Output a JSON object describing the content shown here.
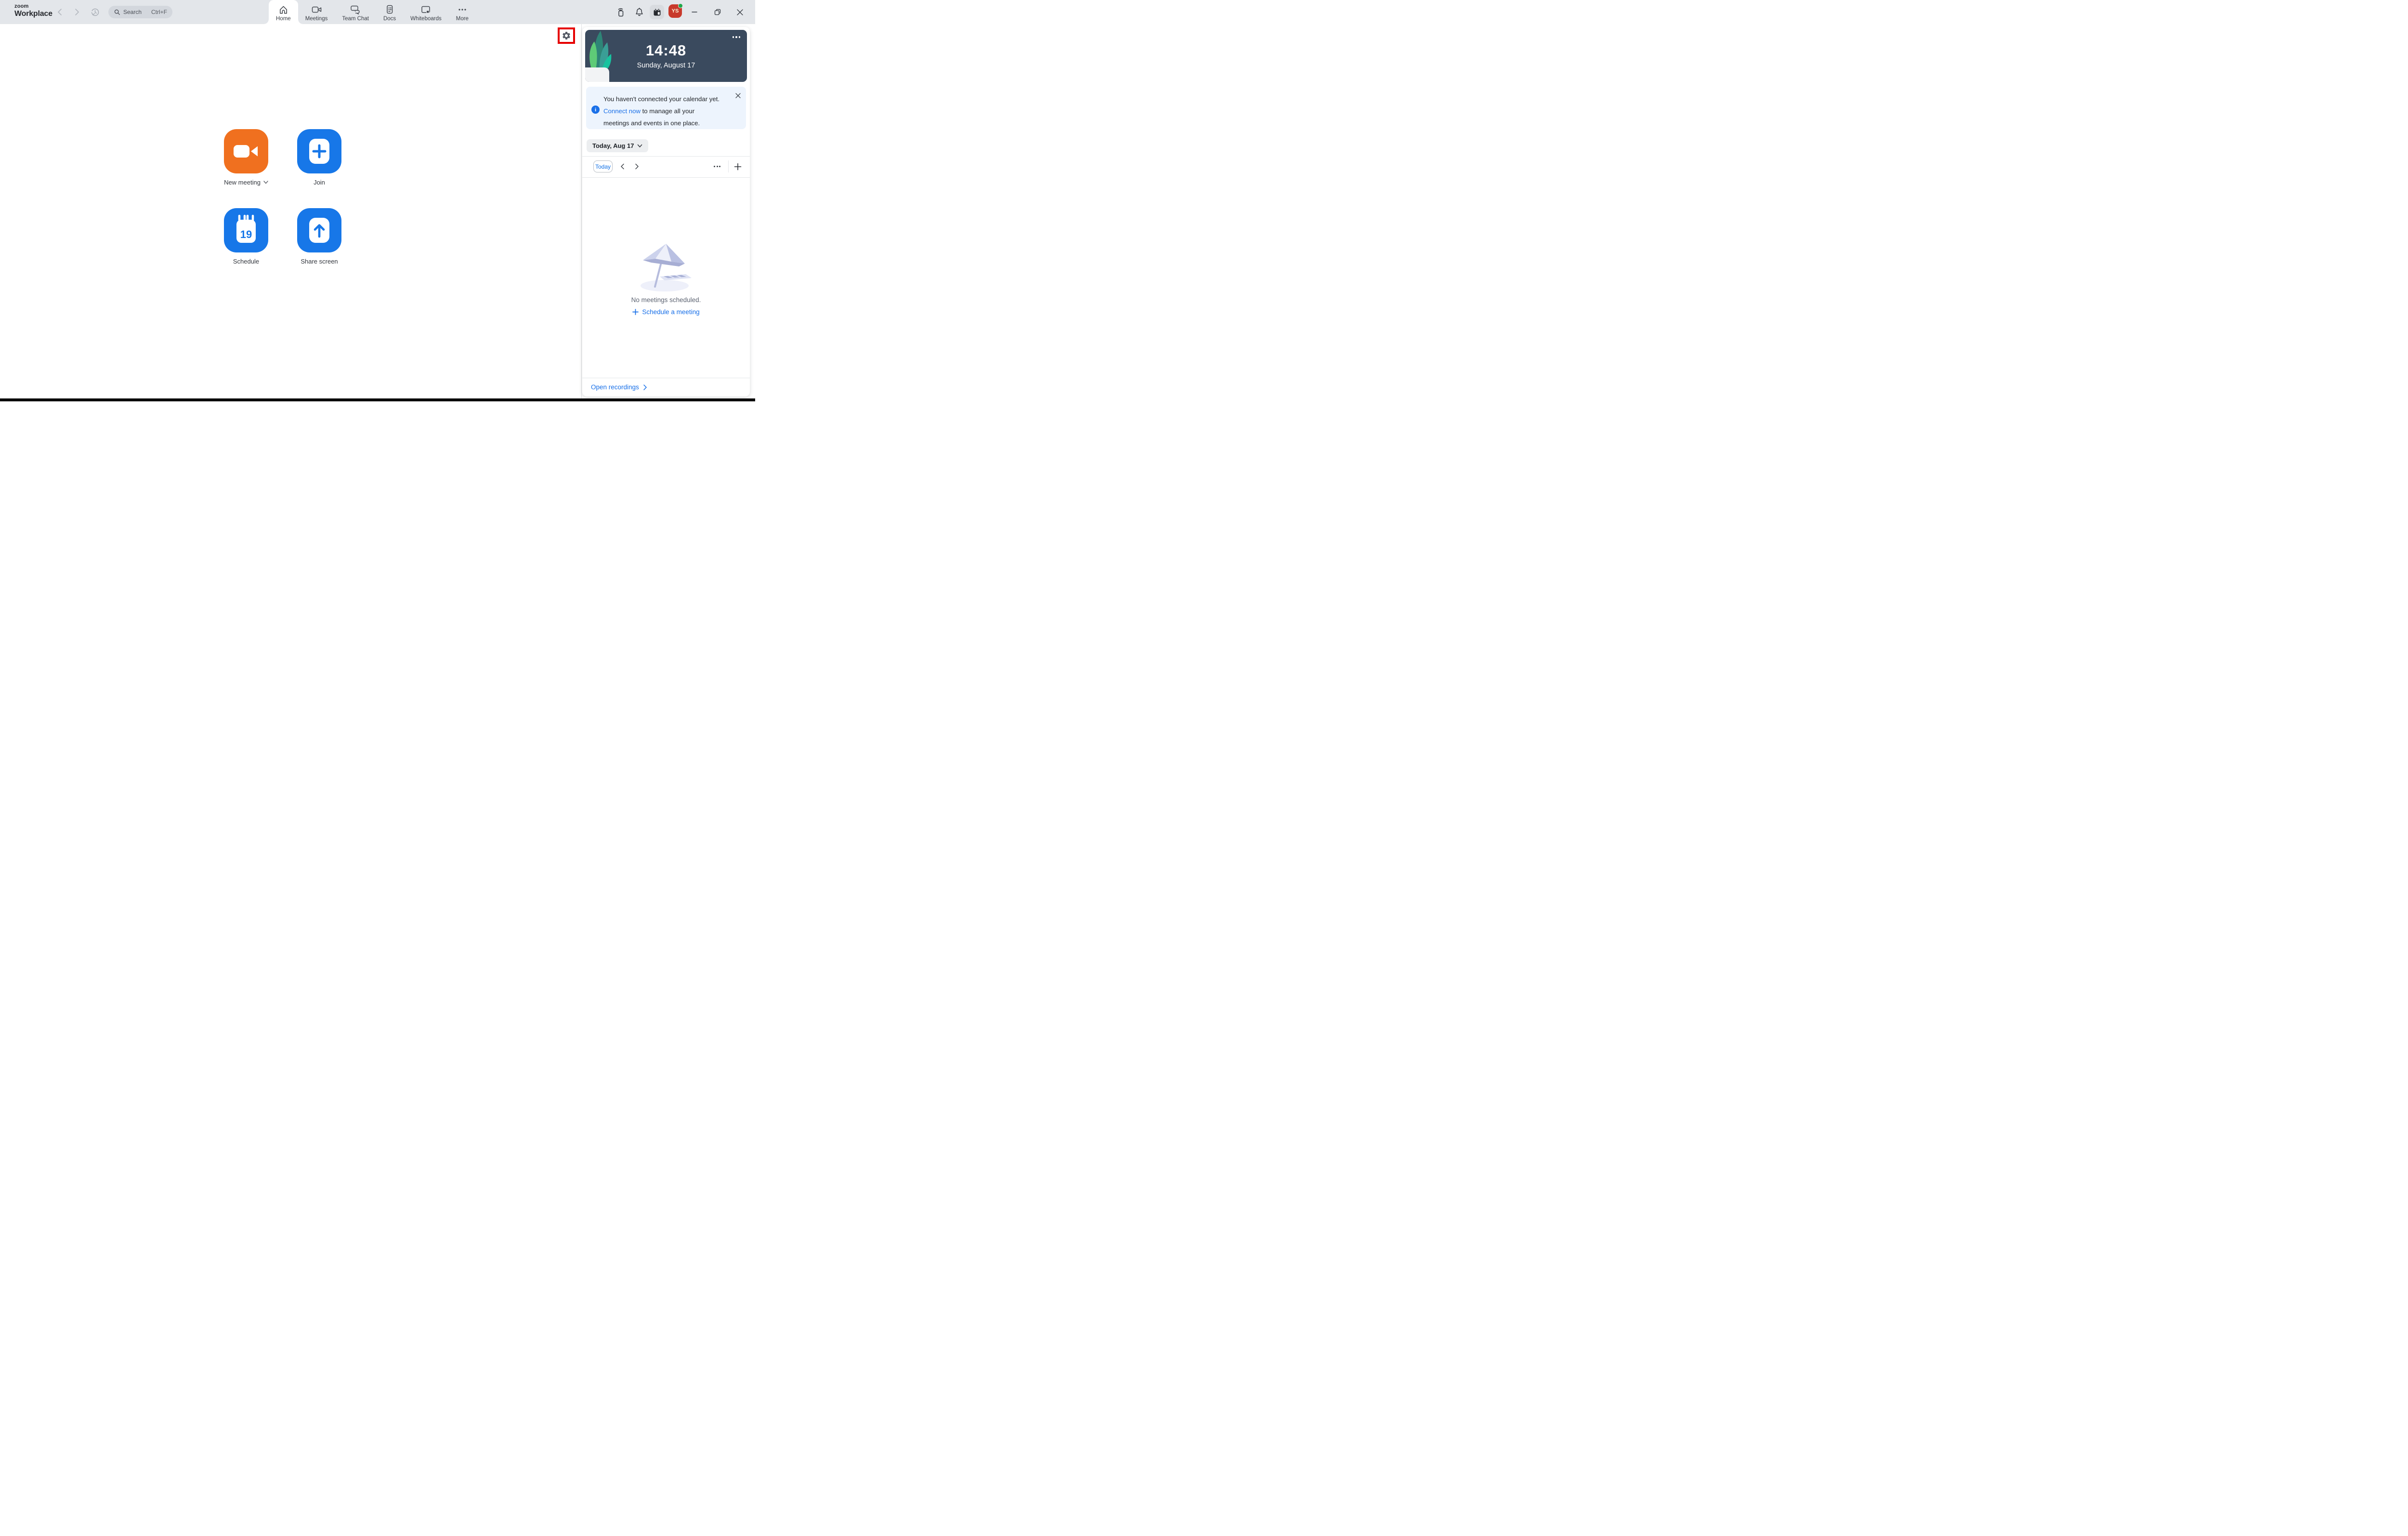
{
  "topbar": {
    "logo": {
      "line1": "zoom",
      "line2": "Workplace"
    },
    "search": {
      "placeholder": "Search",
      "shortcut": "Ctrl+F"
    },
    "tabs": [
      {
        "label": "Home",
        "active": true
      },
      {
        "label": "Meetings",
        "active": false
      },
      {
        "label": "Team Chat",
        "active": false
      },
      {
        "label": "Docs",
        "active": false
      },
      {
        "label": "Whiteboards",
        "active": false
      },
      {
        "label": "More",
        "active": false
      }
    ],
    "avatar": {
      "initials": "YS",
      "status": "online"
    }
  },
  "main": {
    "quick_actions": [
      {
        "label": "New meeting",
        "color": "#F0701F",
        "has_dropdown": true
      },
      {
        "label": "Join",
        "color": "#1777E8"
      },
      {
        "label": "Schedule",
        "color": "#1777E8",
        "calendar_day": "19"
      },
      {
        "label": "Share screen",
        "color": "#1777E8"
      }
    ],
    "annotation": {
      "target": "settings-gear",
      "highlight_color": "#E60000"
    }
  },
  "panel": {
    "clock": {
      "time": "14:48",
      "date": "Sunday, August 17",
      "background": "#3A4A5E"
    },
    "banner": {
      "line1": "You haven't connected your calendar yet.",
      "link_text": "Connect now",
      "line2_rest": " to manage all your",
      "line3": "meetings and events in one place."
    },
    "date_selector": {
      "label": "Today, Aug 17"
    },
    "toolbar": {
      "today": "Today"
    },
    "empty": {
      "message": "No meetings scheduled.",
      "action": "Schedule a meeting"
    },
    "footer": {
      "link": "Open recordings"
    }
  },
  "colors": {
    "accent_blue": "#1777E8",
    "brand_orange": "#F0701F",
    "annotation_red": "#E60000",
    "clock_bg": "#3A4A5E",
    "banner_bg": "#EDF4FD",
    "topbar_bg": "#E3E6EA"
  }
}
